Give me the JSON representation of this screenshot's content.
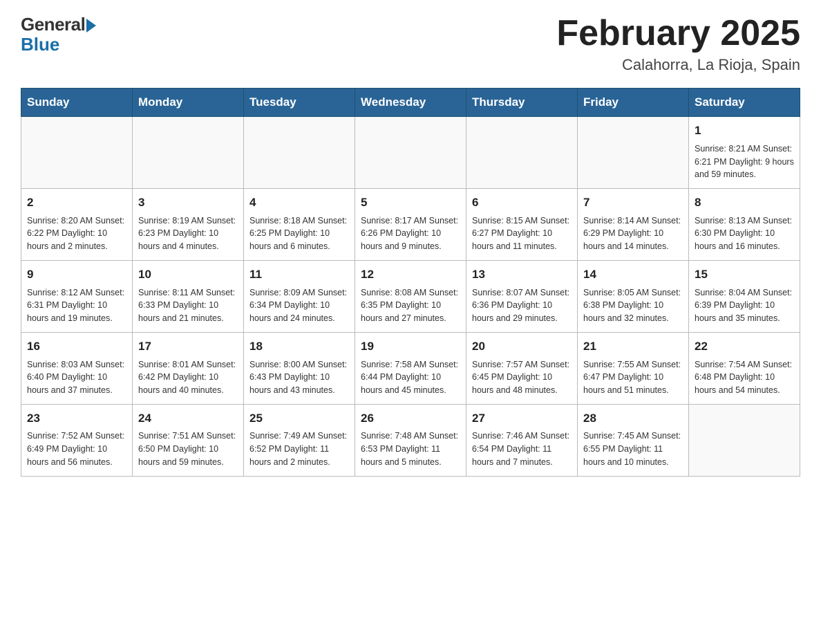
{
  "logo": {
    "general": "General",
    "blue": "Blue"
  },
  "title": "February 2025",
  "subtitle": "Calahorra, La Rioja, Spain",
  "weekdays": [
    "Sunday",
    "Monday",
    "Tuesday",
    "Wednesday",
    "Thursday",
    "Friday",
    "Saturday"
  ],
  "weeks": [
    [
      {
        "day": "",
        "info": ""
      },
      {
        "day": "",
        "info": ""
      },
      {
        "day": "",
        "info": ""
      },
      {
        "day": "",
        "info": ""
      },
      {
        "day": "",
        "info": ""
      },
      {
        "day": "",
        "info": ""
      },
      {
        "day": "1",
        "info": "Sunrise: 8:21 AM\nSunset: 6:21 PM\nDaylight: 9 hours and 59 minutes."
      }
    ],
    [
      {
        "day": "2",
        "info": "Sunrise: 8:20 AM\nSunset: 6:22 PM\nDaylight: 10 hours and 2 minutes."
      },
      {
        "day": "3",
        "info": "Sunrise: 8:19 AM\nSunset: 6:23 PM\nDaylight: 10 hours and 4 minutes."
      },
      {
        "day": "4",
        "info": "Sunrise: 8:18 AM\nSunset: 6:25 PM\nDaylight: 10 hours and 6 minutes."
      },
      {
        "day": "5",
        "info": "Sunrise: 8:17 AM\nSunset: 6:26 PM\nDaylight: 10 hours and 9 minutes."
      },
      {
        "day": "6",
        "info": "Sunrise: 8:15 AM\nSunset: 6:27 PM\nDaylight: 10 hours and 11 minutes."
      },
      {
        "day": "7",
        "info": "Sunrise: 8:14 AM\nSunset: 6:29 PM\nDaylight: 10 hours and 14 minutes."
      },
      {
        "day": "8",
        "info": "Sunrise: 8:13 AM\nSunset: 6:30 PM\nDaylight: 10 hours and 16 minutes."
      }
    ],
    [
      {
        "day": "9",
        "info": "Sunrise: 8:12 AM\nSunset: 6:31 PM\nDaylight: 10 hours and 19 minutes."
      },
      {
        "day": "10",
        "info": "Sunrise: 8:11 AM\nSunset: 6:33 PM\nDaylight: 10 hours and 21 minutes."
      },
      {
        "day": "11",
        "info": "Sunrise: 8:09 AM\nSunset: 6:34 PM\nDaylight: 10 hours and 24 minutes."
      },
      {
        "day": "12",
        "info": "Sunrise: 8:08 AM\nSunset: 6:35 PM\nDaylight: 10 hours and 27 minutes."
      },
      {
        "day": "13",
        "info": "Sunrise: 8:07 AM\nSunset: 6:36 PM\nDaylight: 10 hours and 29 minutes."
      },
      {
        "day": "14",
        "info": "Sunrise: 8:05 AM\nSunset: 6:38 PM\nDaylight: 10 hours and 32 minutes."
      },
      {
        "day": "15",
        "info": "Sunrise: 8:04 AM\nSunset: 6:39 PM\nDaylight: 10 hours and 35 minutes."
      }
    ],
    [
      {
        "day": "16",
        "info": "Sunrise: 8:03 AM\nSunset: 6:40 PM\nDaylight: 10 hours and 37 minutes."
      },
      {
        "day": "17",
        "info": "Sunrise: 8:01 AM\nSunset: 6:42 PM\nDaylight: 10 hours and 40 minutes."
      },
      {
        "day": "18",
        "info": "Sunrise: 8:00 AM\nSunset: 6:43 PM\nDaylight: 10 hours and 43 minutes."
      },
      {
        "day": "19",
        "info": "Sunrise: 7:58 AM\nSunset: 6:44 PM\nDaylight: 10 hours and 45 minutes."
      },
      {
        "day": "20",
        "info": "Sunrise: 7:57 AM\nSunset: 6:45 PM\nDaylight: 10 hours and 48 minutes."
      },
      {
        "day": "21",
        "info": "Sunrise: 7:55 AM\nSunset: 6:47 PM\nDaylight: 10 hours and 51 minutes."
      },
      {
        "day": "22",
        "info": "Sunrise: 7:54 AM\nSunset: 6:48 PM\nDaylight: 10 hours and 54 minutes."
      }
    ],
    [
      {
        "day": "23",
        "info": "Sunrise: 7:52 AM\nSunset: 6:49 PM\nDaylight: 10 hours and 56 minutes."
      },
      {
        "day": "24",
        "info": "Sunrise: 7:51 AM\nSunset: 6:50 PM\nDaylight: 10 hours and 59 minutes."
      },
      {
        "day": "25",
        "info": "Sunrise: 7:49 AM\nSunset: 6:52 PM\nDaylight: 11 hours and 2 minutes."
      },
      {
        "day": "26",
        "info": "Sunrise: 7:48 AM\nSunset: 6:53 PM\nDaylight: 11 hours and 5 minutes."
      },
      {
        "day": "27",
        "info": "Sunrise: 7:46 AM\nSunset: 6:54 PM\nDaylight: 11 hours and 7 minutes."
      },
      {
        "day": "28",
        "info": "Sunrise: 7:45 AM\nSunset: 6:55 PM\nDaylight: 11 hours and 10 minutes."
      },
      {
        "day": "",
        "info": ""
      }
    ]
  ]
}
